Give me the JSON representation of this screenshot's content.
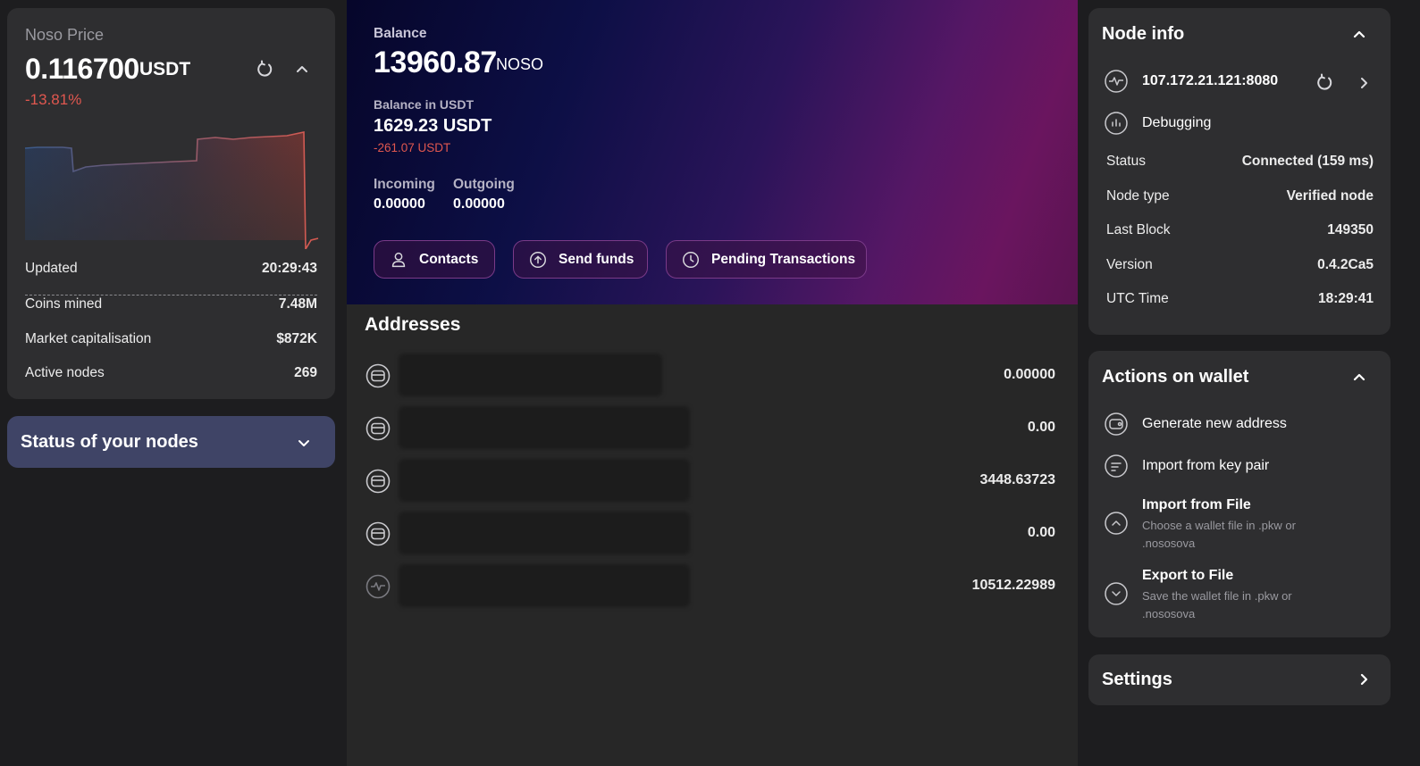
{
  "price": {
    "label": "Noso Price",
    "value": "0.116700",
    "unit": "USDT",
    "change": "-13.81%",
    "stats": [
      {
        "label": "Updated",
        "value": "20:29:43"
      },
      {
        "label": "Coins mined",
        "value": "7.48M"
      },
      {
        "label": "Market capitalisation",
        "value": "$872K"
      },
      {
        "label": "Active nodes",
        "value": "269"
      }
    ],
    "colors": {
      "up": "#3a5a8a",
      "down": "#d85a50"
    }
  },
  "nodes_status": {
    "title": "Status of your nodes",
    "icon": "chevron-down-icon"
  },
  "balance": {
    "label": "Balance",
    "value": "13960.87",
    "unit": "NOSO",
    "usdt_label": "Balance in USDT",
    "usdt_value": "1629.23 USDT",
    "usdt_change": "-261.07 USDT",
    "incoming_label": "Incoming",
    "incoming_value": "0.00000",
    "outgoing_label": "Outgoing",
    "outgoing_value": "0.00000"
  },
  "actions": {
    "contacts": "Contacts",
    "send": "Send funds",
    "pending": "Pending Transactions"
  },
  "addresses": {
    "title": "Addresses",
    "items": [
      {
        "icon": "wallet-icon",
        "value": "0.00000"
      },
      {
        "icon": "wallet-icon",
        "value": "0.00"
      },
      {
        "icon": "wallet-icon",
        "value": "3448.63723"
      },
      {
        "icon": "wallet-icon",
        "value": "0.00"
      },
      {
        "icon": "node-activity-icon",
        "value": "10512.22989"
      }
    ]
  },
  "node_info": {
    "title": "Node info",
    "address": "107.172.21.121:8080",
    "debugging": "Debugging",
    "rows": [
      {
        "label": "Status",
        "value": "Connected (159 ms)"
      },
      {
        "label": "Node type",
        "value": "Verified node"
      },
      {
        "label": "Last Block",
        "value": "149350"
      },
      {
        "label": "Version",
        "value": "0.4.2Ca5"
      },
      {
        "label": "UTC Time",
        "value": "18:29:41"
      }
    ]
  },
  "wallet_actions": {
    "title": "Actions on wallet",
    "generate": "Generate new address",
    "import_keypair": "Import from key pair",
    "import_file": "Import from File",
    "import_file_sub": "Choose a wallet file in .pkw or .nososova",
    "export_file": "Export to File",
    "export_file_sub": "Save the wallet file in .pkw or .nososova"
  },
  "settings": {
    "title": "Settings"
  }
}
